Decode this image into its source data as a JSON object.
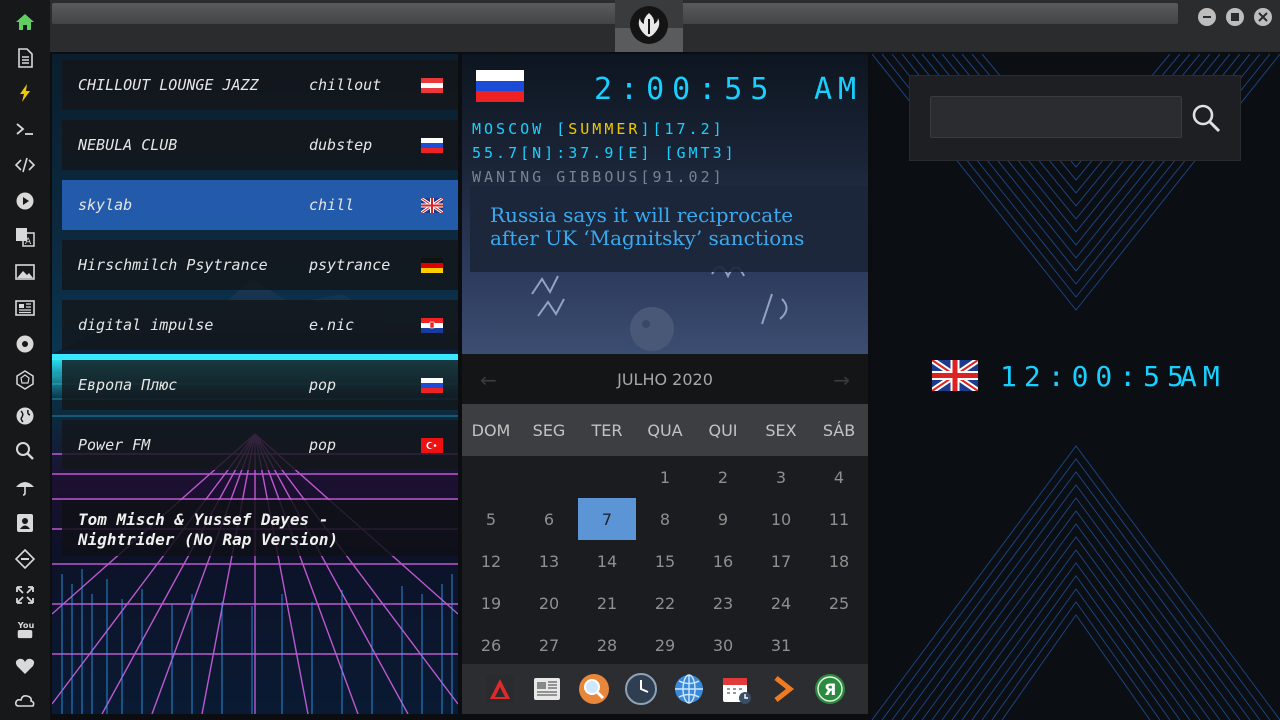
{
  "sidebar": {
    "icons": [
      "home-icon",
      "document-icon",
      "lightning-icon",
      "terminal-icon",
      "code-icon",
      "play-icon",
      "translate-icon",
      "image-icon",
      "newspaper-icon",
      "rebel-icon",
      "dodecahedron-icon",
      "globe-icon",
      "search-icon",
      "umbrella-icon",
      "contact-icon",
      "git-icon",
      "expand-icon",
      "youtube-icon",
      "heart-icon",
      "cloud-link-icon"
    ],
    "youtube_label": "You"
  },
  "radio": {
    "stations": [
      {
        "name": "CHILLOUT LOUNGE JAZZ",
        "genre": "chillout",
        "flag": "AT",
        "active": false
      },
      {
        "name": "NEBULA CLUB",
        "genre": "dubstep",
        "flag": "RU",
        "active": false
      },
      {
        "name": "skylab",
        "genre": "chill",
        "flag": "GB",
        "active": true
      },
      {
        "name": "Hirschmilch Psytrance",
        "genre": "psytrance",
        "flag": "DE",
        "active": false
      },
      {
        "name": "digital impulse",
        "genre": "e.nic",
        "flag": "HR",
        "active": false
      },
      {
        "name": "Европа Плюс",
        "genre": "pop",
        "flag": "RU",
        "active": false
      },
      {
        "name": "Power FM",
        "genre": "pop",
        "flag": "TR",
        "active": false
      }
    ],
    "now_playing_line1": "Tom Misch & Yussef Dayes -",
    "now_playing_line2": "Nightrider (No Rap Version)"
  },
  "world_clock": {
    "time": "2:00:55",
    "ampm": "AM",
    "city_prefix": "MOSCOW [",
    "city_highlight": "SUMMER",
    "city_suffix": "][17.2]",
    "coords": "55.7[N]:37.9[E] [GMT3]",
    "moon": "WANING GIBBOUS[91.02]",
    "flag": "RU"
  },
  "news": {
    "headline": "Russia says it will reciprocate after UK ‘Magnitsky’ sanctions"
  },
  "calendar": {
    "month_label": "JULHO 2020",
    "prev_icon": "chevron-left-icon",
    "next_icon": "chevron-right-icon",
    "weekdays": [
      "DOM",
      "SEG",
      "TER",
      "QUA",
      "QUI",
      "SEX",
      "SÁB"
    ],
    "weeks": [
      [
        "",
        "",
        "",
        "1",
        "2",
        "3",
        "4"
      ],
      [
        "5",
        "6",
        "7",
        "8",
        "9",
        "10",
        "11"
      ],
      [
        "12",
        "13",
        "14",
        "15",
        "16",
        "17",
        "18"
      ],
      [
        "19",
        "20",
        "21",
        "22",
        "23",
        "24",
        "25"
      ],
      [
        "26",
        "27",
        "28",
        "29",
        "30",
        "31",
        ""
      ]
    ],
    "today": "7"
  },
  "dock": {
    "icons": [
      "red-app-icon",
      "news-app-icon",
      "magnifier-app-icon",
      "clock-app-icon",
      "globe-app-icon",
      "calendar-app-icon",
      "arrow-app-icon",
      "yandex-app-icon"
    ]
  },
  "right": {
    "search_placeholder": "",
    "time": "12:00:55",
    "ampm": "AM",
    "flag": "GB"
  },
  "colors": {
    "accent_lcd": "#18d0ff",
    "active_station": "#2864be",
    "today_cell": "#5b95d5",
    "headline": "#3aaaf0",
    "home_icon": "#5fcf5f"
  }
}
